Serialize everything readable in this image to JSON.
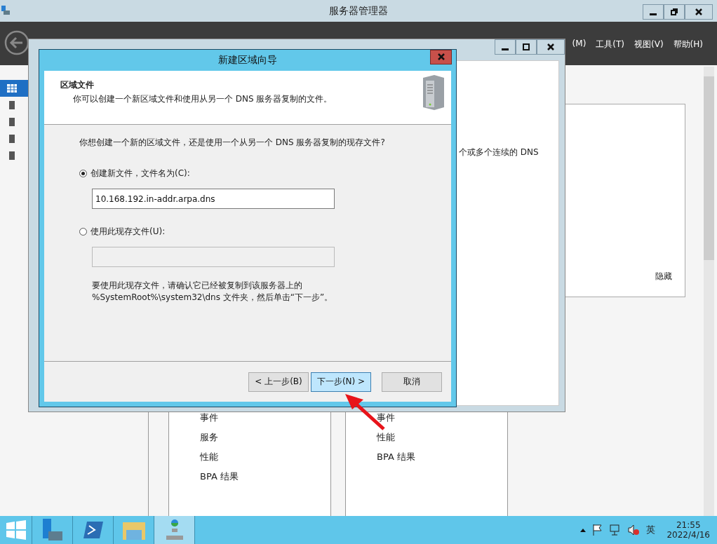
{
  "main_window": {
    "title": "服务器管理器",
    "menu": [
      "(M)",
      "工具(T)",
      "视图(V)",
      "帮助(H)"
    ],
    "sidebar_items": [
      {
        "selected": true
      },
      {
        "selected": false
      },
      {
        "selected": false
      },
      {
        "selected": false
      },
      {
        "selected": false
      }
    ],
    "panel_text": "个或多个连续的 DNS",
    "hide_link": "隐藏",
    "tiles": [
      {
        "items": [
          "事件",
          "服务",
          "性能",
          "BPA 结果"
        ]
      },
      {
        "items": [
          "事件",
          "性能",
          "BPA 结果"
        ]
      }
    ]
  },
  "dialog": {
    "title": "新建区域向导",
    "header_title": "区域文件",
    "header_description": "你可以创建一个新区域文件和使用从另一个 DNS 服务器复制的文件。",
    "question": "你想创建一个新的区域文件，还是使用一个从另一个 DNS 服务器复制的现存文件?",
    "options": [
      {
        "label": "创建新文件，文件名为(C):",
        "selected": true,
        "value": "10.168.192.in-addr.arpa.dns"
      },
      {
        "label": "使用此现存文件(U):",
        "selected": false
      }
    ],
    "note": "要使用此现存文件，请确认它已经被复制到该服务器上的\n%SystemRoot%\\system32\\dns 文件夹，然后单击“下一步”。",
    "buttons": [
      {
        "label": "< 上一步(B)",
        "focused": false
      },
      {
        "label": "下一步(N) >",
        "focused": true
      },
      {
        "label": "取消",
        "focused": false
      }
    ]
  },
  "taskbar": {
    "apps": [
      {
        "selected": false
      },
      {
        "selected": false
      },
      {
        "selected": false
      },
      {
        "selected": true
      }
    ],
    "ime": "英",
    "time": "21:55",
    "date": "2022/4/16"
  }
}
